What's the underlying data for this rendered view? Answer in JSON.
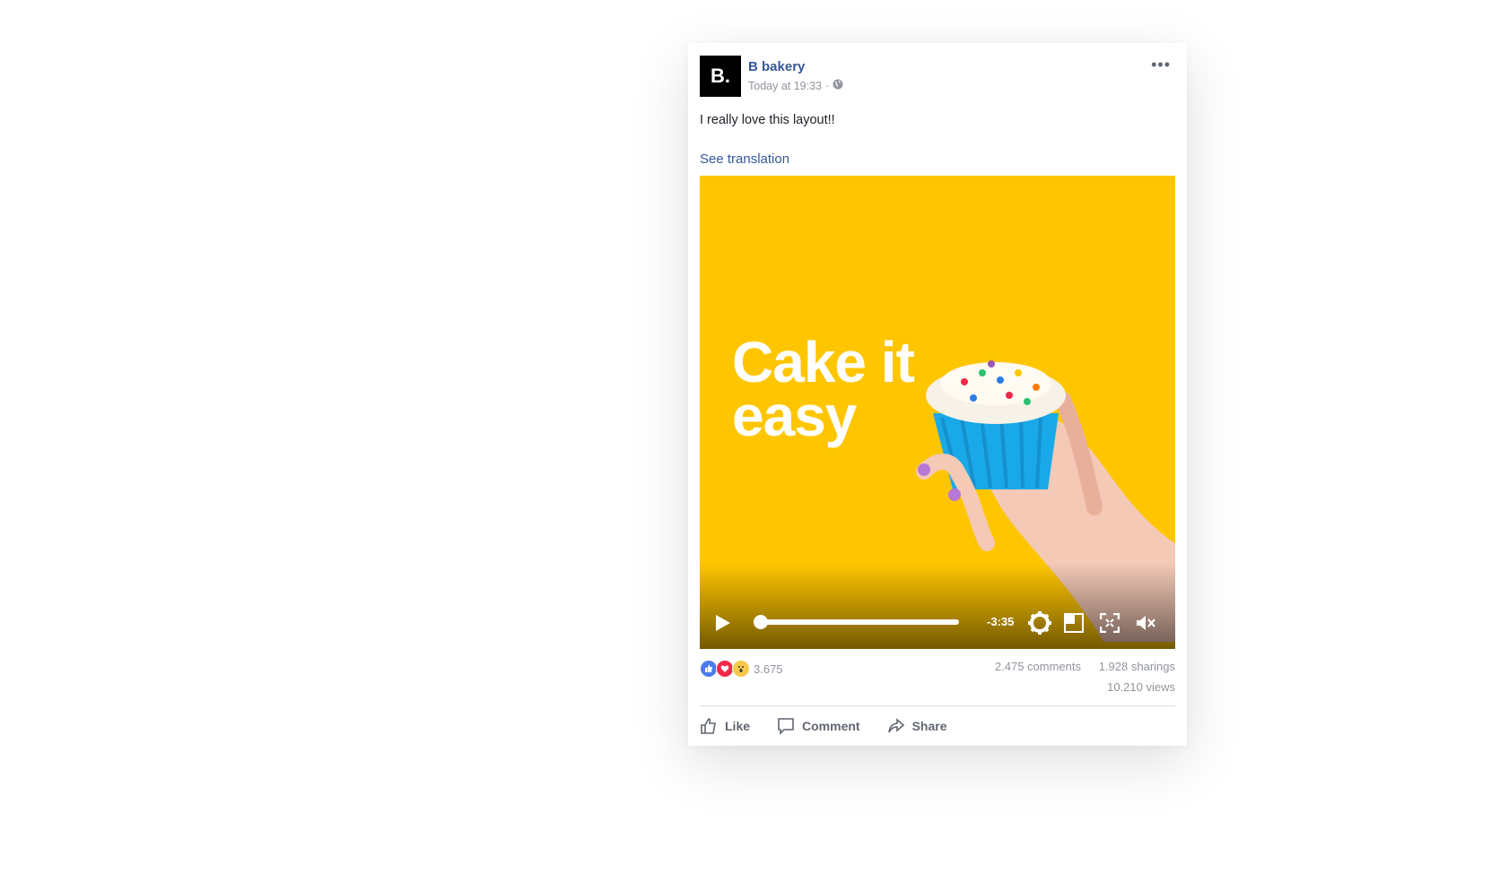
{
  "post": {
    "author": "B bakery",
    "avatar_text": "B.",
    "timestamp": "Today at 19:33",
    "separator": "·",
    "text": "I really love this layout!!",
    "translate_link": "See translation"
  },
  "video": {
    "headline_line1": "Cake it",
    "headline_line2": "easy",
    "time_remaining": "-3:35",
    "progress": 0.0
  },
  "stats": {
    "reaction_count": "3.675",
    "comments": "2.475 comments",
    "sharings": "1.928 sharings",
    "views": "10.210 views"
  },
  "actions": {
    "like": "Like",
    "comment": "Comment",
    "share": "Share"
  },
  "colors": {
    "link": "#365899",
    "video_bg": "#ffc600",
    "cupcake": "#19a9e8",
    "like_blue": "#4b7bec",
    "love_red": "#f0284a",
    "wow_yellow": "#f7c94a"
  }
}
